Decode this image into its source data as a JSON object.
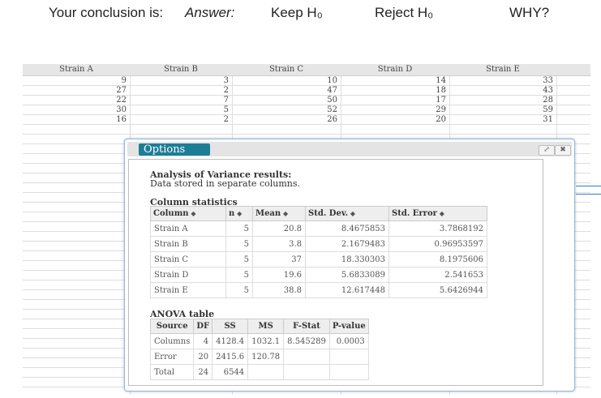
{
  "question": {
    "prompt": "Your conclusion is:",
    "answer_label": "Answer:",
    "keep_option": "Keep H₀",
    "reject_option": "Reject H₀",
    "why": "WHY?"
  },
  "sheet": {
    "headers": [
      "Strain A",
      "Strain B",
      "Strain C",
      "Strain D",
      "Strain E"
    ],
    "rows": [
      [
        "9",
        "3",
        "10",
        "14",
        "33"
      ],
      [
        "27",
        "2",
        "47",
        "18",
        "43"
      ],
      [
        "22",
        "7",
        "50",
        "17",
        "28"
      ],
      [
        "30",
        "5",
        "52",
        "29",
        "59"
      ],
      [
        "16",
        "2",
        "26",
        "20",
        "31"
      ]
    ]
  },
  "window": {
    "options_label": "Options",
    "title": "Analysis of Variance results:",
    "subtitle": "Data stored in separate columns.",
    "column_stats_title": "Column statistics",
    "stats_headers": [
      "Column",
      "n",
      "Mean",
      "Std. Dev.",
      "Std. Error"
    ],
    "stats_rows": [
      [
        "Strain A",
        "5",
        "20.8",
        "8.4675853",
        "3.7868192"
      ],
      [
        "Strain B",
        "5",
        "3.8",
        "2.1679483",
        "0.96953597"
      ],
      [
        "Strain C",
        "5",
        "37",
        "18.330303",
        "8.1975606"
      ],
      [
        "Strain D",
        "5",
        "19.6",
        "5.6833089",
        "2.541653"
      ],
      [
        "Strain E",
        "5",
        "38.8",
        "12.617448",
        "5.6426944"
      ]
    ],
    "anova_title": "ANOVA table",
    "anova_headers": [
      "Source",
      "DF",
      "SS",
      "MS",
      "F-Stat",
      "P-value"
    ],
    "anova_rows": [
      [
        "Columns",
        "4",
        "4128.4",
        "1032.1",
        "8.545289",
        "0.0003"
      ],
      [
        "Error",
        "20",
        "2415.6",
        "120.78",
        "",
        ""
      ],
      [
        "Total",
        "24",
        "6544",
        "",
        "",
        ""
      ]
    ]
  }
}
